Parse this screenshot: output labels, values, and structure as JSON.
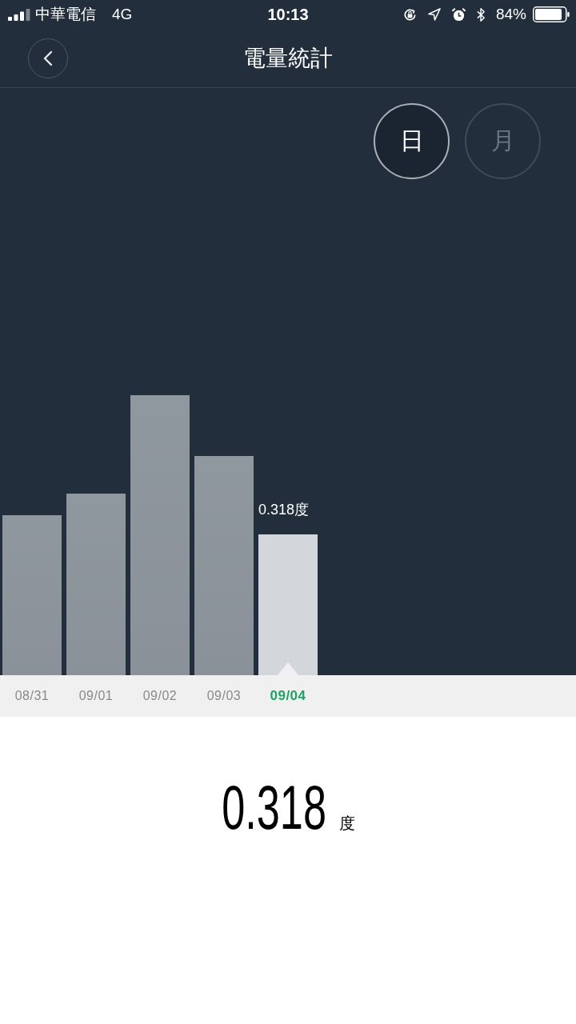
{
  "status_bar": {
    "carrier": "中華電信",
    "network": "4G",
    "time": "10:13",
    "battery": "84%"
  },
  "header": {
    "title": "電量統計"
  },
  "period_toggle": [
    {
      "label": "日",
      "selected": true
    },
    {
      "label": "月",
      "selected": false
    }
  ],
  "chart": {
    "value_label": "0.318度",
    "days": [
      {
        "label": "08/31",
        "selected": false
      },
      {
        "label": "09/01",
        "selected": false
      },
      {
        "label": "09/02",
        "selected": false
      },
      {
        "label": "09/03",
        "selected": false
      },
      {
        "label": "09/04",
        "selected": true
      }
    ]
  },
  "summary": {
    "value": "0.318",
    "unit": "度"
  }
}
